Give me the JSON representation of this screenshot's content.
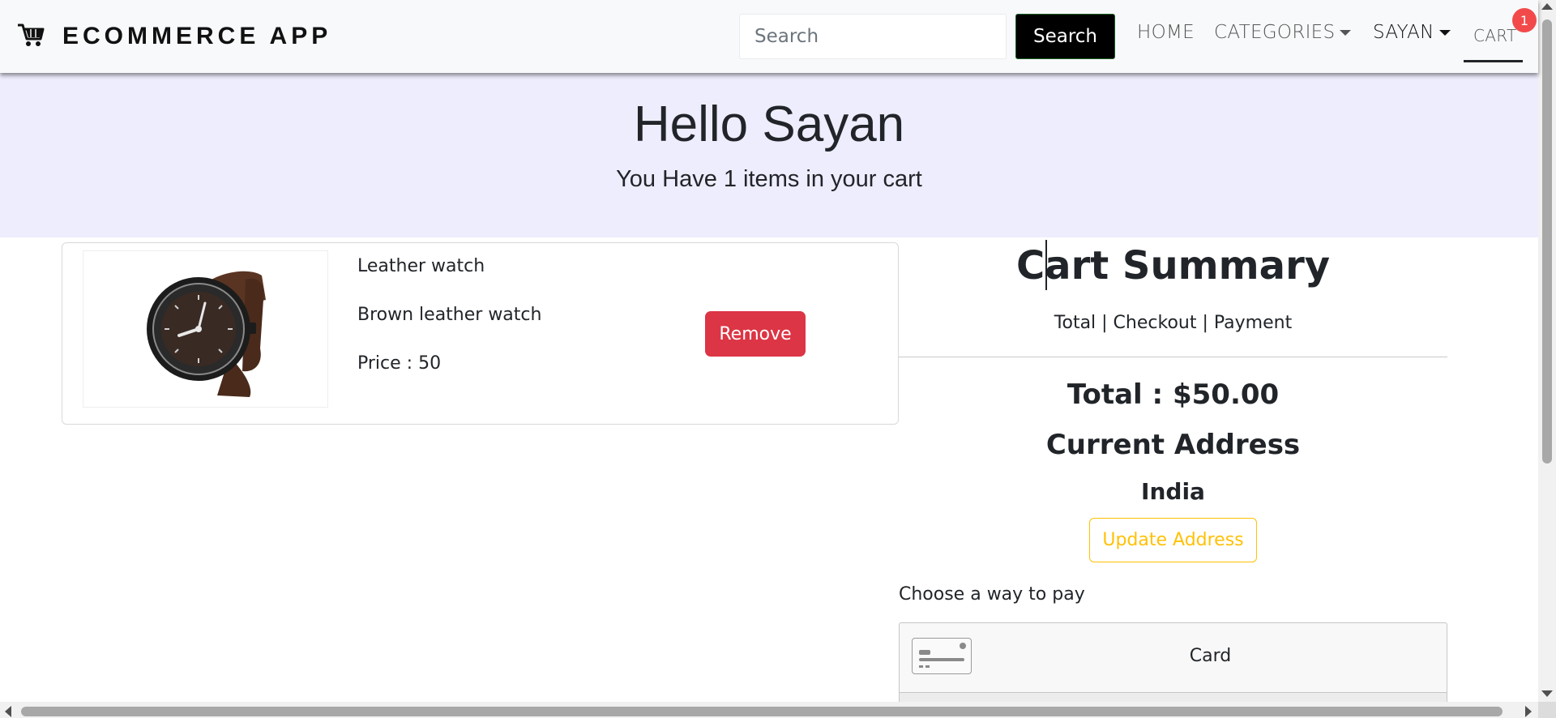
{
  "navbar": {
    "brand": "ECOMMERCE APP",
    "brand_icon": "shopping-cart-icon",
    "search_placeholder": "Search",
    "search_button": "Search",
    "links": {
      "home": "HOME",
      "categories": "CATEGORIES",
      "user": "SAYAN",
      "cart": "CART"
    },
    "cart_badge": "1",
    "badge_color": "#f24a4a"
  },
  "hero": {
    "greeting": "Hello Sayan",
    "subtitle": "You Have 1 items in your cart",
    "background": "#eeedfe"
  },
  "cart_items": [
    {
      "name": "Leather watch",
      "description": "Brown leather watch",
      "price": "Price : 50",
      "image_icon": "wristwatch-icon",
      "remove_label": "Remove"
    }
  ],
  "summary": {
    "title": "Cart Summary",
    "subtitle": "Total | Checkout | Payment",
    "total": "Total : $50.00",
    "address_heading": "Current Address",
    "address": "India",
    "update_address": "Update Address",
    "pay_label": "Choose a way to pay",
    "payment_option": "Card",
    "payment_icon": "credit-card-icon"
  },
  "colors": {
    "remove": "#dc3545",
    "update": "#ffc107",
    "search_button": "#000000"
  }
}
